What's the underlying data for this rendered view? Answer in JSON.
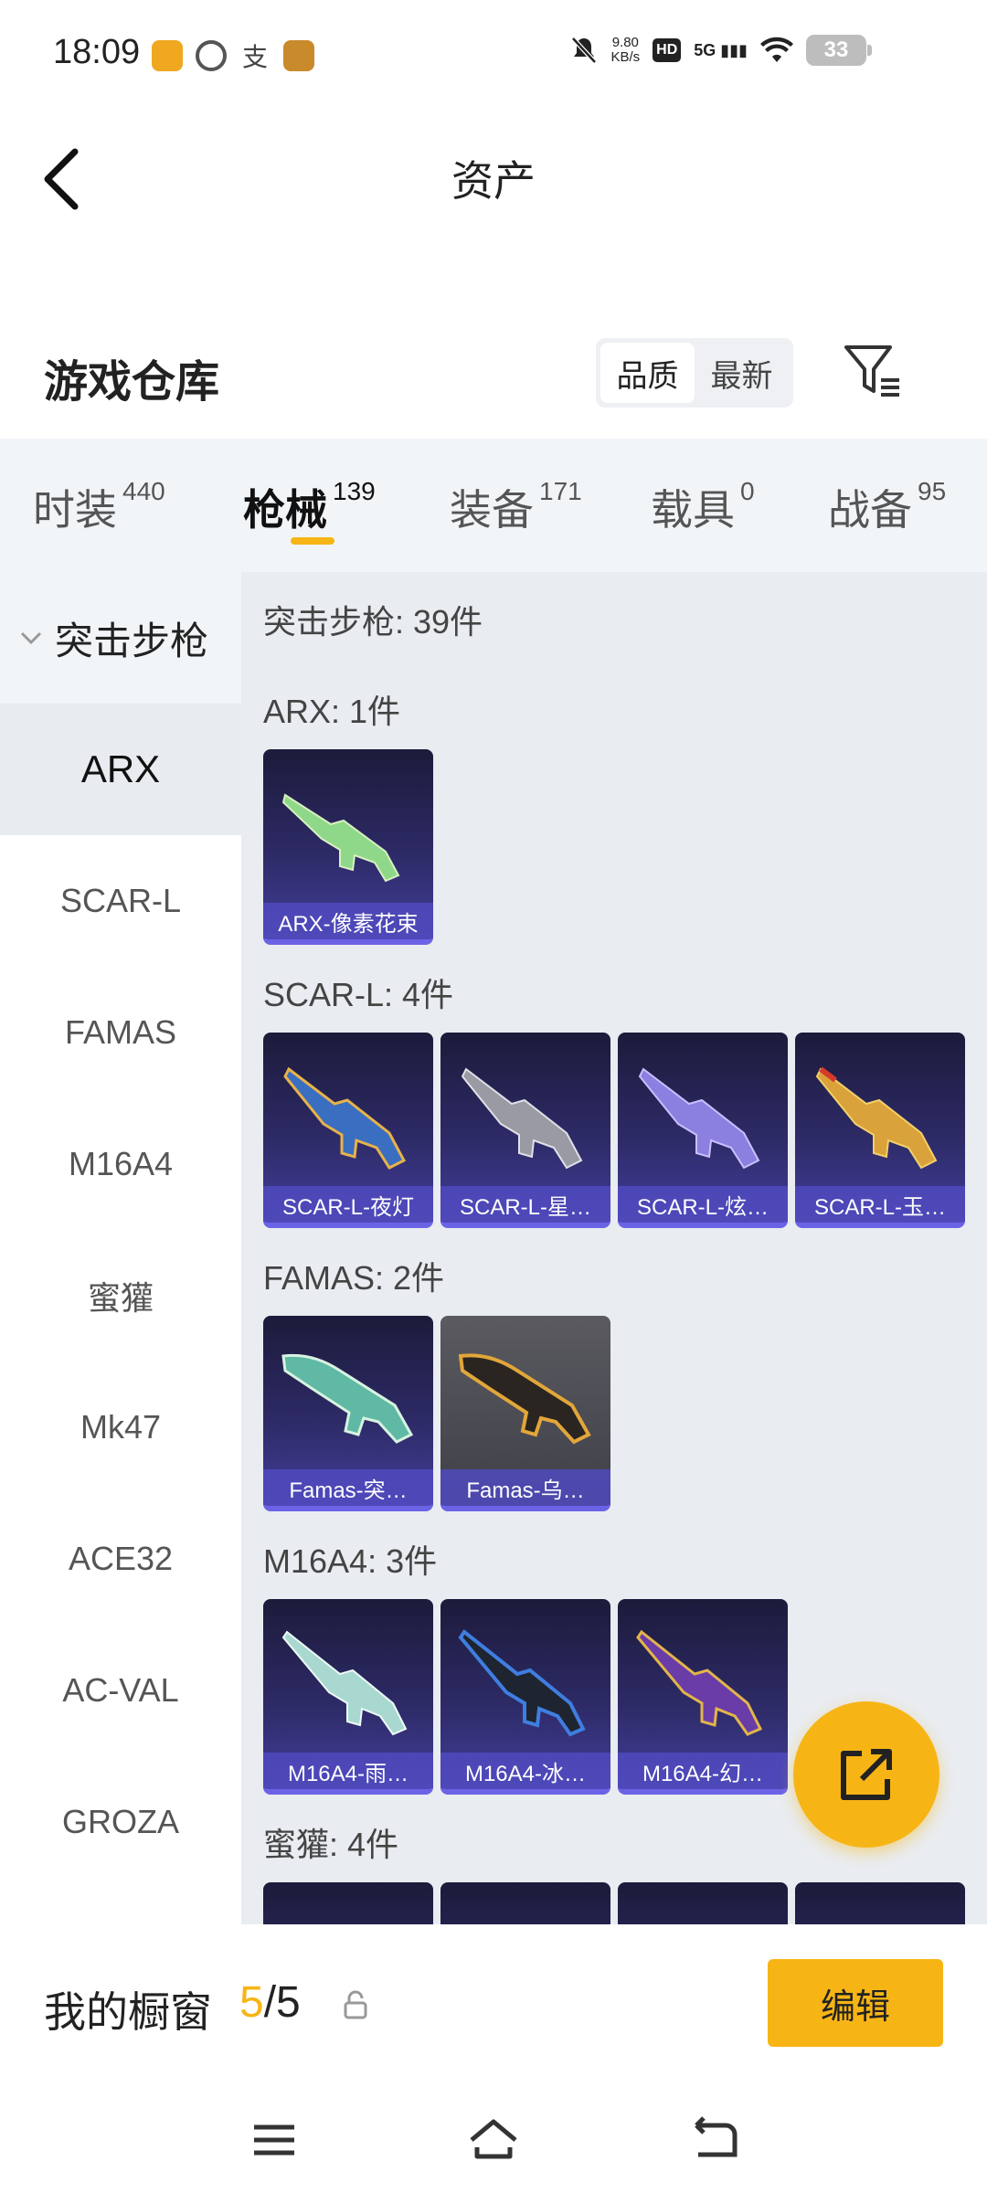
{
  "status_bar": {
    "time": "18:09",
    "net_speed_value": "9.80",
    "net_speed_unit": "KB/s",
    "hd": "HD",
    "signal": "5G",
    "battery": "33"
  },
  "header": {
    "title": "资产"
  },
  "warehouse": {
    "title": "游戏仓库",
    "sort_options": [
      "品质",
      "最新"
    ]
  },
  "category_tabs": [
    {
      "label": "时装",
      "count": "440"
    },
    {
      "label": "枪械",
      "count": "139"
    },
    {
      "label": "装备",
      "count": "171"
    },
    {
      "label": "载具",
      "count": "0"
    },
    {
      "label": "战备",
      "count": "95"
    }
  ],
  "sidebar": {
    "subcategory": "突击步枪",
    "items": [
      "ARX",
      "SCAR-L",
      "FAMAS",
      "M16A4",
      "蜜獾",
      "Mk47",
      "ACE32",
      "AC-VAL",
      "GROZA"
    ]
  },
  "content": {
    "total": "突击步枪: 39件",
    "groups": [
      {
        "title": "ARX: 1件",
        "items": [
          "ARX-像素花束"
        ]
      },
      {
        "title": "SCAR-L: 4件",
        "items": [
          "SCAR-L-夜灯",
          "SCAR-L-星…",
          "SCAR-L-炫…",
          "SCAR-L-玉…"
        ]
      },
      {
        "title": "FAMAS: 2件",
        "items": [
          "Famas-突…",
          "Famas-乌…"
        ]
      },
      {
        "title": "M16A4: 3件",
        "items": [
          "M16A4-雨…",
          "M16A4-冰…",
          "M16A4-幻…"
        ]
      },
      {
        "title": "蜜獾: 4件",
        "items": []
      }
    ]
  },
  "bottom_panel": {
    "label": "我的橱窗",
    "current": "5",
    "separator": "/",
    "max": "5",
    "edit_label": "编辑"
  },
  "colors": {
    "accent": "#f7b515",
    "card_purple": "#433e9a",
    "card_border": "#6b63e6"
  }
}
